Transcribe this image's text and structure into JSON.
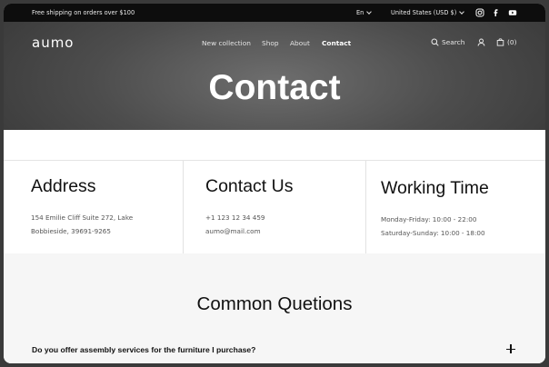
{
  "announcement": {
    "text": "Free shipping on orders over $100",
    "language": "En",
    "region": "United States (USD $)",
    "social_icons": [
      "instagram-icon",
      "facebook-icon",
      "youtube-icon"
    ]
  },
  "header": {
    "logo": "aumo",
    "nav": [
      "New collection",
      "Shop",
      "About",
      "Contact"
    ],
    "active_nav": "Contact",
    "search_label": "Search",
    "cart_count": "(0)"
  },
  "hero": {
    "title": "Contact"
  },
  "info": {
    "address": {
      "title": "Address",
      "lines": [
        "154 Emilie Cliff Suite 272, Lake",
        "Bobbieside, 39691-9265"
      ]
    },
    "contact": {
      "title": "Contact Us",
      "lines": [
        "+1 123 12 34 459",
        "aumo@mail.com"
      ]
    },
    "hours": {
      "title": "Working Time",
      "lines": [
        "Monday-Friday: 10:00 - 22:00",
        "Saturday-Sunday: 10:00 - 18:00"
      ]
    }
  },
  "faq": {
    "title": "Common Quetions",
    "questions": [
      "Do you offer assembly services for the furniture I purchase?"
    ]
  }
}
